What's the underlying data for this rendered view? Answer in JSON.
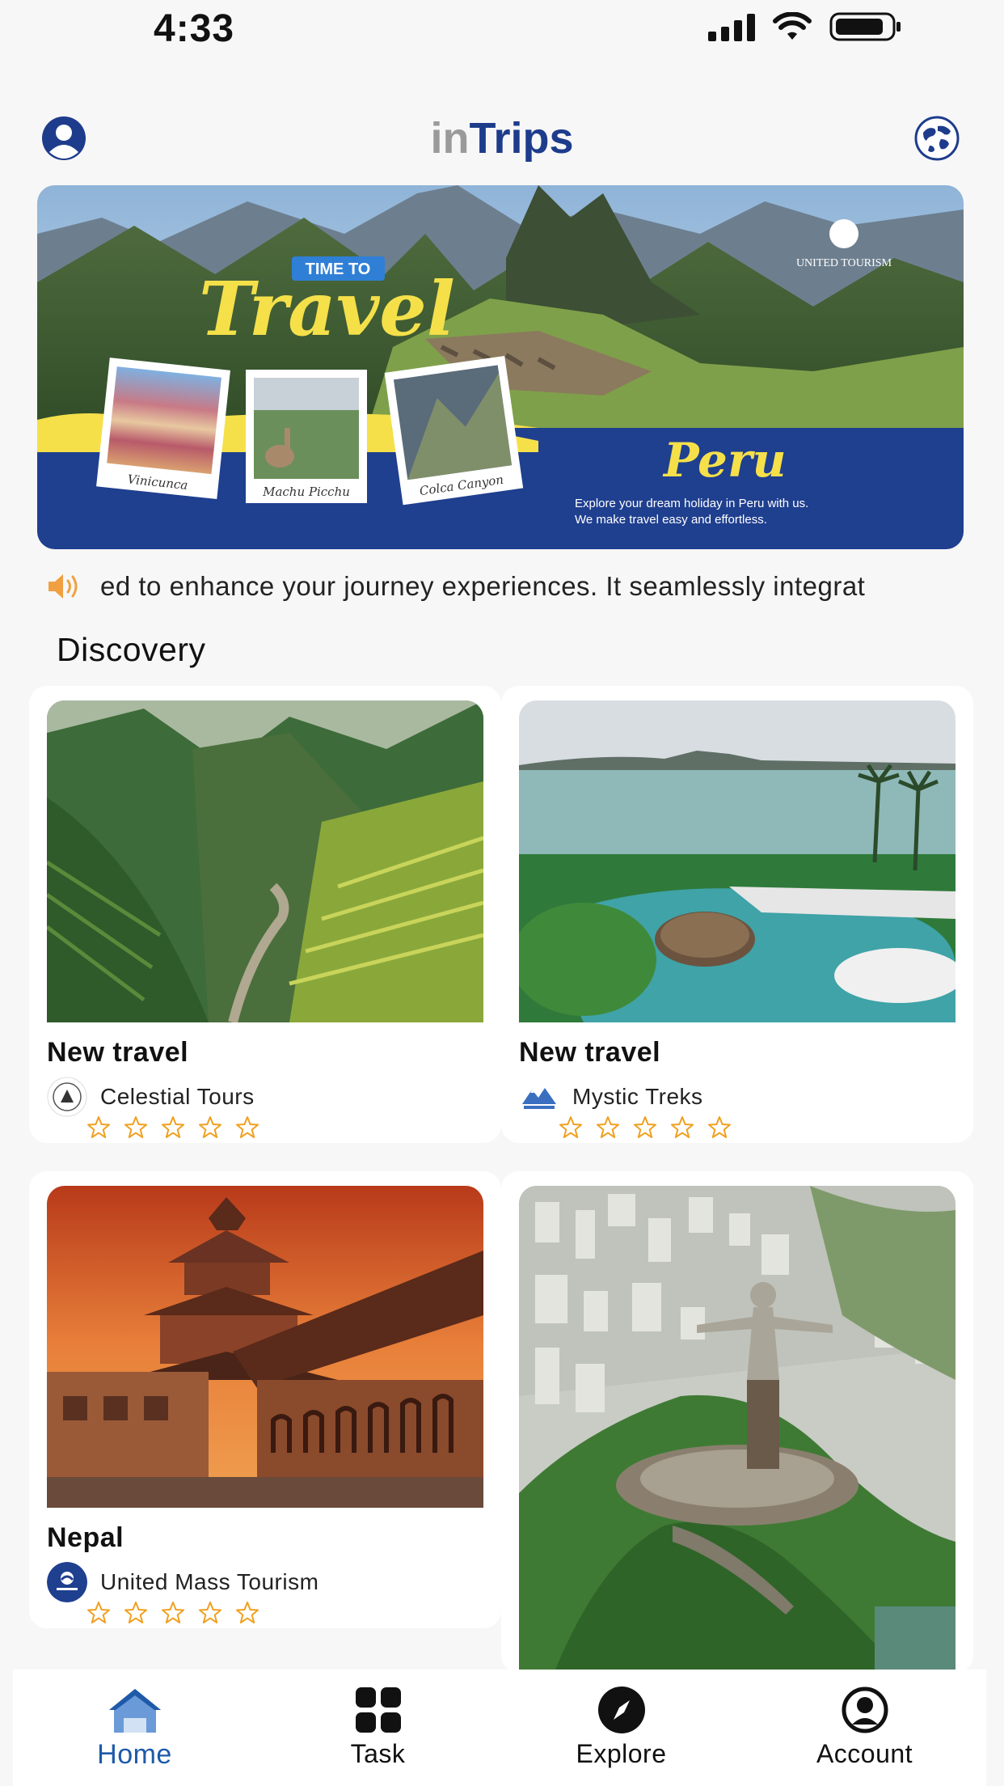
{
  "status_bar": {
    "time": "4:33"
  },
  "header": {
    "title_light": "in",
    "title_strong": "Trips",
    "avatar_icon": "user-circle-icon",
    "globe_icon": "globe-icon",
    "brand_color": "#1e3c8c"
  },
  "banner": {
    "time_to": "TIME TO",
    "headline": "Travel",
    "destination": "Peru",
    "brand": "UNITED TOURISM",
    "tagline_1": "Explore your dream holiday in Peru with us.",
    "tagline_2": "We make travel easy and effortless.",
    "photo_captions": [
      "Vinicunca",
      "Machu Picchu",
      "Colca Canyon"
    ]
  },
  "announcement": {
    "icon": "speaker-icon",
    "text": "ed to enhance your journey experiences. It seamlessly integrat"
  },
  "discovery": {
    "title": "Discovery",
    "cards": [
      {
        "title": "New travel",
        "company": "Celestial Tours",
        "rating": 0,
        "max_rating": 5
      },
      {
        "title": "New travel",
        "company": "Mystic Treks",
        "rating": 0,
        "max_rating": 5
      },
      {
        "title": "Nepal",
        "company": "United Mass Tourism",
        "rating": 0,
        "max_rating": 5
      },
      {
        "title": "",
        "company": "",
        "rating": 0,
        "max_rating": 5
      }
    ]
  },
  "tabbar": {
    "active": "Home",
    "accent_color": "#1e5aa8",
    "items": [
      {
        "label": "Home",
        "icon": "home-icon"
      },
      {
        "label": "Task",
        "icon": "grid-icon"
      },
      {
        "label": "Explore",
        "icon": "compass-icon"
      },
      {
        "label": "Account",
        "icon": "account-icon"
      }
    ]
  }
}
